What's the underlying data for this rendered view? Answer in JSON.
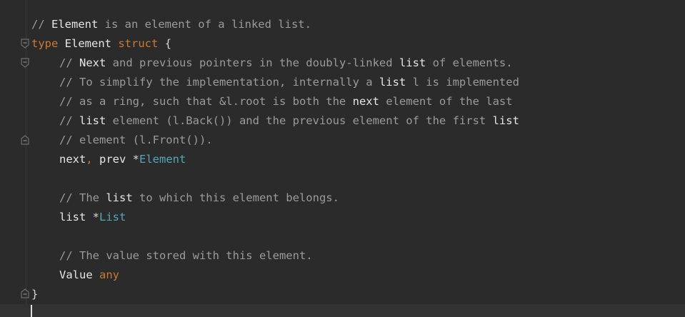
{
  "editor": {
    "language": "Go",
    "lines": [
      {
        "comment": "// ",
        "w1": "Element",
        "rest": " is an element of a linked list."
      },
      {
        "kw1": "type",
        "name": "Element",
        "kw2": "struct",
        "brace": "{"
      },
      {
        "comment": "// ",
        "w1": "Next",
        "mid1": " and previous pointers in the doubly-linked ",
        "w2": "list",
        "rest": " of elements."
      },
      {
        "comment": "// To simplify the implementation, internally a ",
        "w1": "list",
        "rest": " l is implemented"
      },
      {
        "comment": "// as a ring, such that &l.root is both the ",
        "w1": "next",
        "rest": " element of the last"
      },
      {
        "comment": "// ",
        "w1": "list",
        "mid1": " element (l.Back()) and the previous element of the first ",
        "w2": "list"
      },
      {
        "comment": "// element (l.Front())."
      },
      {
        "f1": "next",
        "sep": ",",
        "f2": " prev ",
        "star": "*",
        "typ": "Element"
      },
      {},
      {
        "comment": "// The ",
        "w1": "list",
        "rest": " to which this element belongs."
      },
      {
        "f1": "list ",
        "star": "*",
        "typ": "List"
      },
      {},
      {
        "comment": "// The value stored with this element."
      },
      {
        "f1": "Value ",
        "typ": "any"
      },
      {
        "brace": "}"
      }
    ]
  },
  "colors": {
    "background": "#2b2b2b",
    "comment": "#9b9b9b",
    "keyword": "#cc7832",
    "type_reference": "#56a8b5",
    "identifier": "#e6e6e6"
  },
  "icons": {
    "fold_open": "fold-collapse-icon",
    "fold_close": "fold-end-icon"
  }
}
